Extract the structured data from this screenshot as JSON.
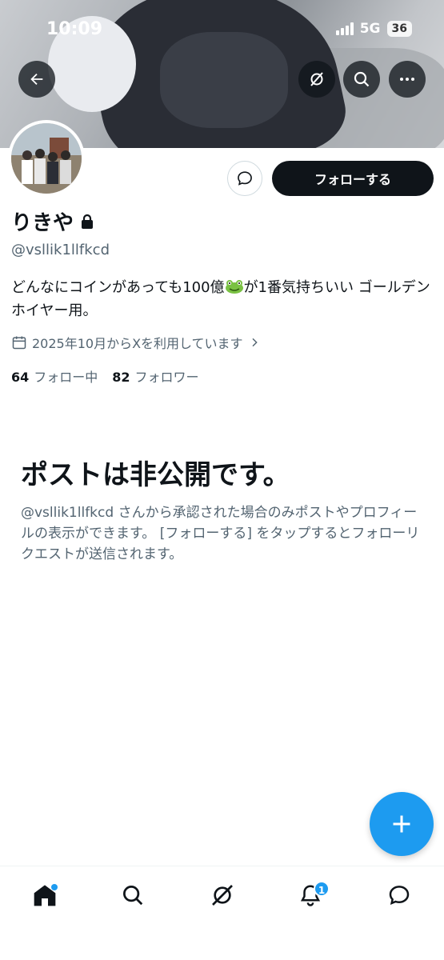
{
  "status_bar": {
    "time": "10:09",
    "network": "5G",
    "battery": "36"
  },
  "profile": {
    "display_name": "りきや",
    "handle": "@vsllik1llfkcd",
    "bio_before_emoji": "どんなにコインがあっても100億",
    "bio_after_emoji": "が1番気持ちいい ゴールデンホイヤー用。",
    "joined": "2025年10月からXを利用しています",
    "following_count": "64",
    "following_label": "フォロー中",
    "followers_count": "82",
    "followers_label": "フォロワー"
  },
  "actions": {
    "follow_label": "フォローする"
  },
  "private_notice": {
    "title": "ポストは非公開です。",
    "description": "@vsllik1llfkcd さんから承認された場合のみポストやプロフィールの表示ができます。 [フォローする] をタップするとフォローリクエストが送信されます。"
  },
  "bottom_nav": {
    "items": [
      {
        "icon": "home-icon",
        "badge_dot": true
      },
      {
        "icon": "search-icon"
      },
      {
        "icon": "grok-icon"
      },
      {
        "icon": "bell-icon",
        "badge": "1"
      },
      {
        "icon": "messages-icon"
      }
    ]
  },
  "colors": {
    "accent": "#1d9bf0",
    "text": "#0f1419",
    "secondary": "#536471"
  }
}
